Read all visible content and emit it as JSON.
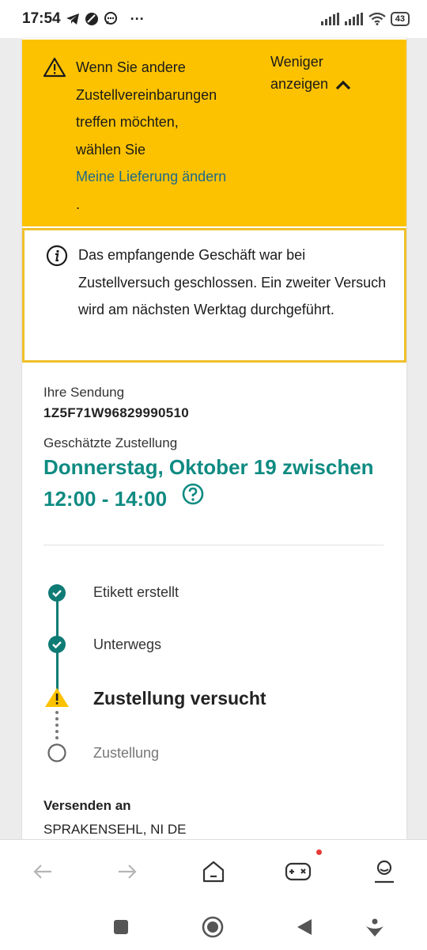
{
  "status_bar": {
    "time": "17:54",
    "more": "···",
    "battery": "43"
  },
  "alert": {
    "lines": [
      "Wenn Sie andere",
      "Zustellvereinbarungen",
      "treffen möchten,",
      "wählen Sie"
    ],
    "link": "Meine Lieferung ändern",
    "period": ".",
    "toggle_line1": "Weniger",
    "toggle_line2": "anzeigen"
  },
  "info": {
    "text": "Das empfangende Geschäft war bei Zustellversuch geschlossen. Ein zweiter Versuch wird am nächsten Werktag durchgeführt."
  },
  "shipment": {
    "label": "Ihre Sendung",
    "tracking_number": "1Z5F71W96829990510",
    "est_label": "Geschätzte Zustellung",
    "est_line1": "Donnerstag, Oktober 19 zwischen",
    "est_line2": "12:00 - 14:00"
  },
  "steps": [
    {
      "label": "Etikett erstellt",
      "state": "done"
    },
    {
      "label": "Unterwegs",
      "state": "done"
    },
    {
      "label": "Zustellung versucht",
      "state": "warning"
    },
    {
      "label": "Zustellung",
      "state": "pending"
    }
  ],
  "ship_to": {
    "label": "Versenden an",
    "value": "SPRAKENSEHL, NI DE"
  },
  "colors": {
    "accent": "#0f8b82",
    "alert_bg": "#fcc200",
    "info_border": "#f0c02a",
    "link": "#1e6a8a"
  }
}
